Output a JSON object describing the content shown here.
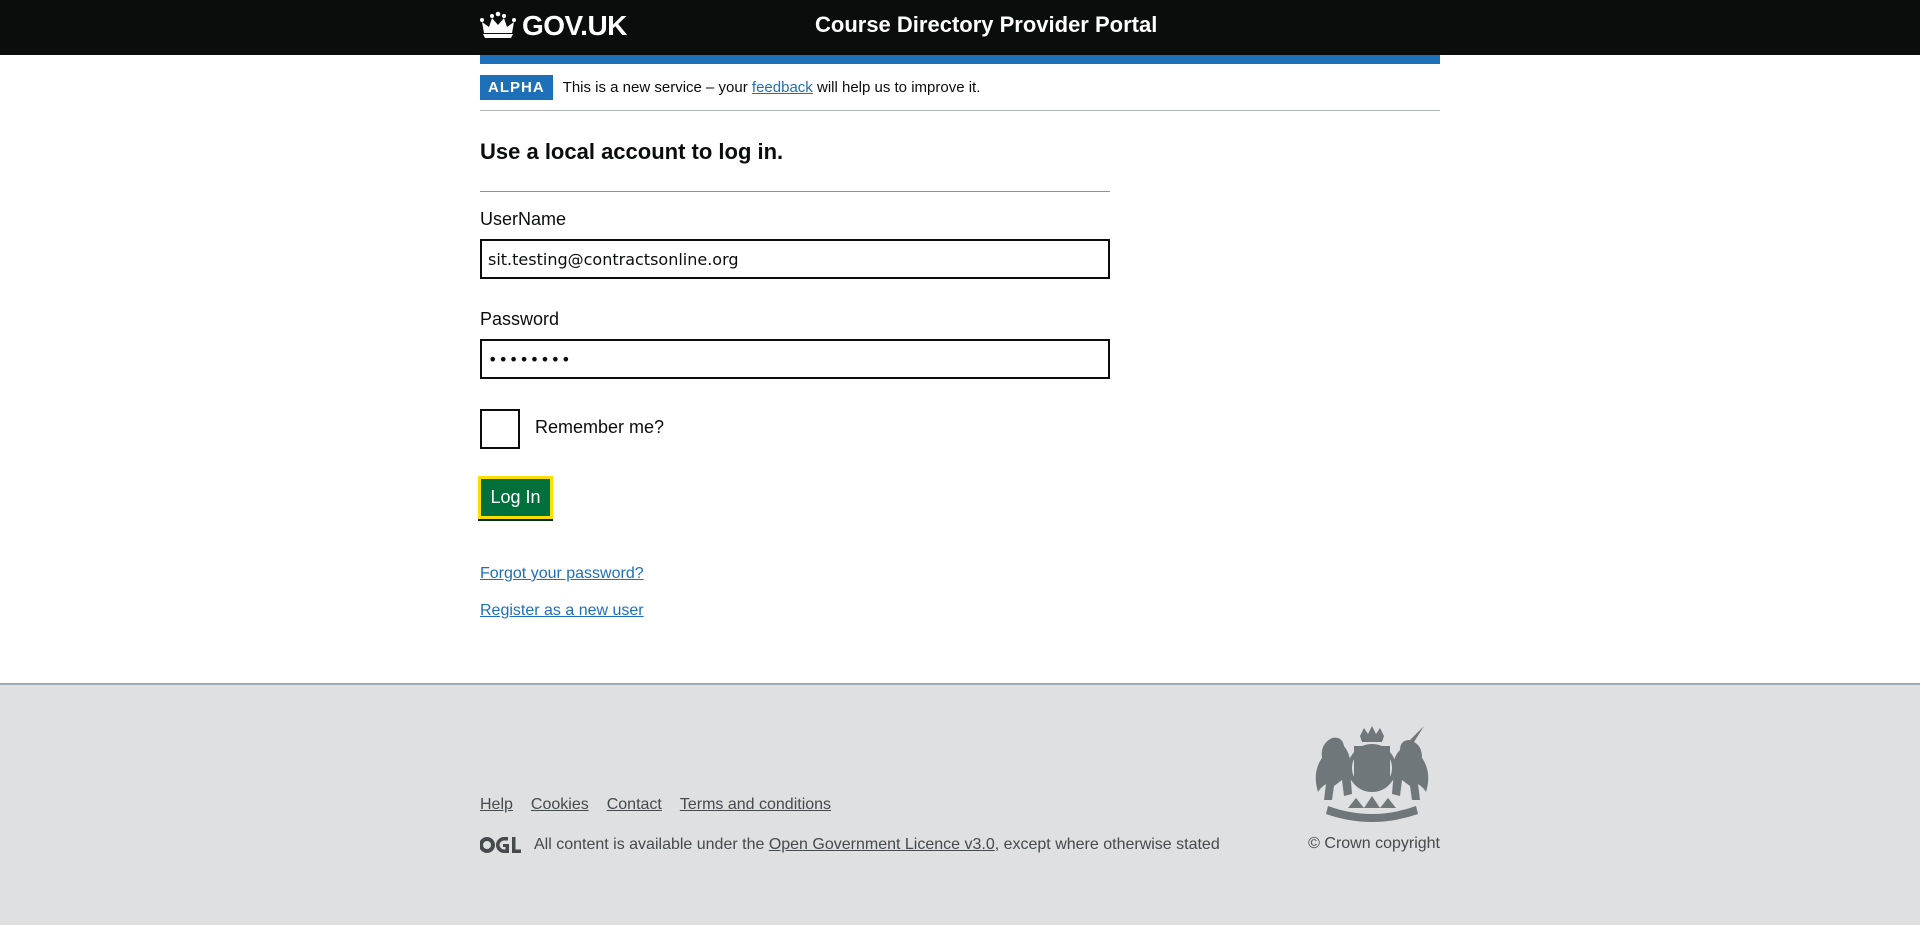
{
  "header": {
    "logo_text": "GOV.UK",
    "service_name": "Course Directory Provider Portal"
  },
  "phase_banner": {
    "tag": "ALPHA",
    "text_before": "This is a new service – your ",
    "link": "feedback",
    "text_after": " will help us to improve it."
  },
  "login": {
    "heading": "Use a local account to log in.",
    "username_label": "UserName",
    "username_value": "sit.testing@contractsonline.org",
    "password_label": "Password",
    "password_value": "••••••••",
    "remember_label": "Remember me?",
    "remember_checked": false,
    "submit_label": "Log In",
    "forgot_link": "Forgot your password?",
    "register_link": "Register as a new user"
  },
  "footer": {
    "links": [
      "Help",
      "Cookies",
      "Contact",
      "Terms and conditions"
    ],
    "licence_before": "All content is available under the ",
    "licence_link": "Open Government Licence v3.0",
    "licence_after": ", except where otherwise stated",
    "copyright": "© Crown copyright"
  },
  "colors": {
    "header_bg": "#0b0c0c",
    "brand_blue": "#1d70b8",
    "button_green": "#00703c",
    "focus_yellow": "#ffdd00",
    "footer_bg": "#dee0e2"
  },
  "icons": {
    "logo": "crown-icon",
    "licence": "ogl-logo-icon",
    "crest": "royal-coat-of-arms-icon"
  }
}
